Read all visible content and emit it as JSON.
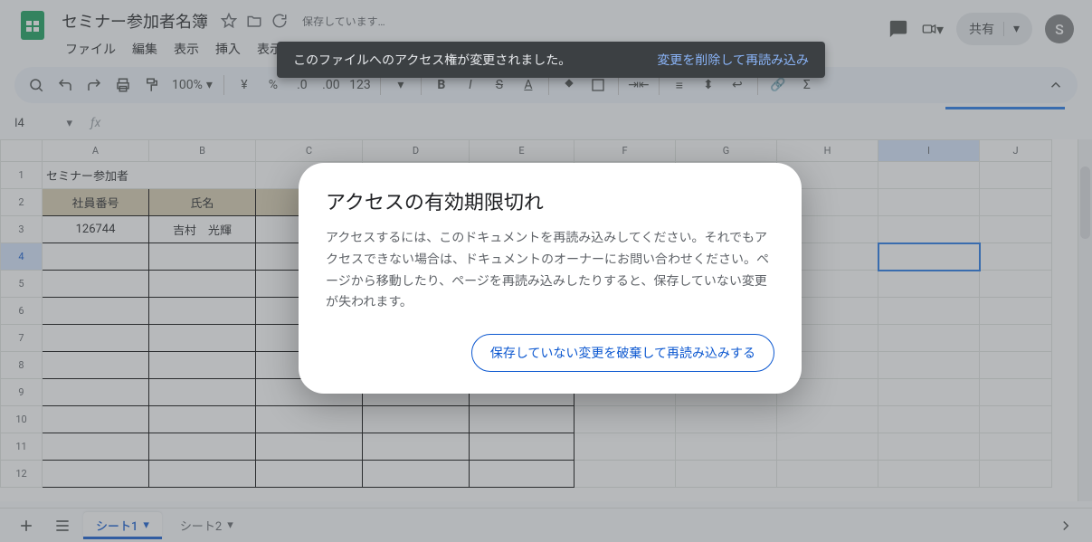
{
  "doc": {
    "title": "セミナー参加者名簿",
    "saving_label": "保存しています…"
  },
  "menus": [
    "ファイル",
    "編集",
    "表示",
    "挿入",
    "表示"
  ],
  "header": {
    "share_label": "共有",
    "avatar_initial": "S"
  },
  "toolbar": {
    "zoom": "100%"
  },
  "name_box": "I4",
  "columns": [
    "A",
    "B",
    "C",
    "D",
    "E",
    "F",
    "G",
    "H",
    "I",
    "J"
  ],
  "row_numbers": [
    "1",
    "2",
    "3",
    "4",
    "5",
    "6",
    "7",
    "8",
    "9",
    "10",
    "11",
    "12"
  ],
  "cells": {
    "a1": "セミナー参加者",
    "a2": "社員番号",
    "b2": "氏名",
    "a3": "126744",
    "b3": "吉村　光輝"
  },
  "tabs": {
    "sheet1": "シート1",
    "sheet2": "シート2"
  },
  "toast": {
    "message": "このファイルへのアクセス権が変更されました。",
    "action": "変更を削除して再読み込み"
  },
  "dialog": {
    "title": "アクセスの有効期限切れ",
    "body": "アクセスするには、このドキュメントを再読み込みしてください。それでもアクセスできない場合は、ドキュメントのオーナーにお問い合わせください。ページから移動したり、ページを再読み込みしたりすると、保存していない変更が失われます。",
    "button": "保存していない変更を破棄して再読み込みする"
  }
}
